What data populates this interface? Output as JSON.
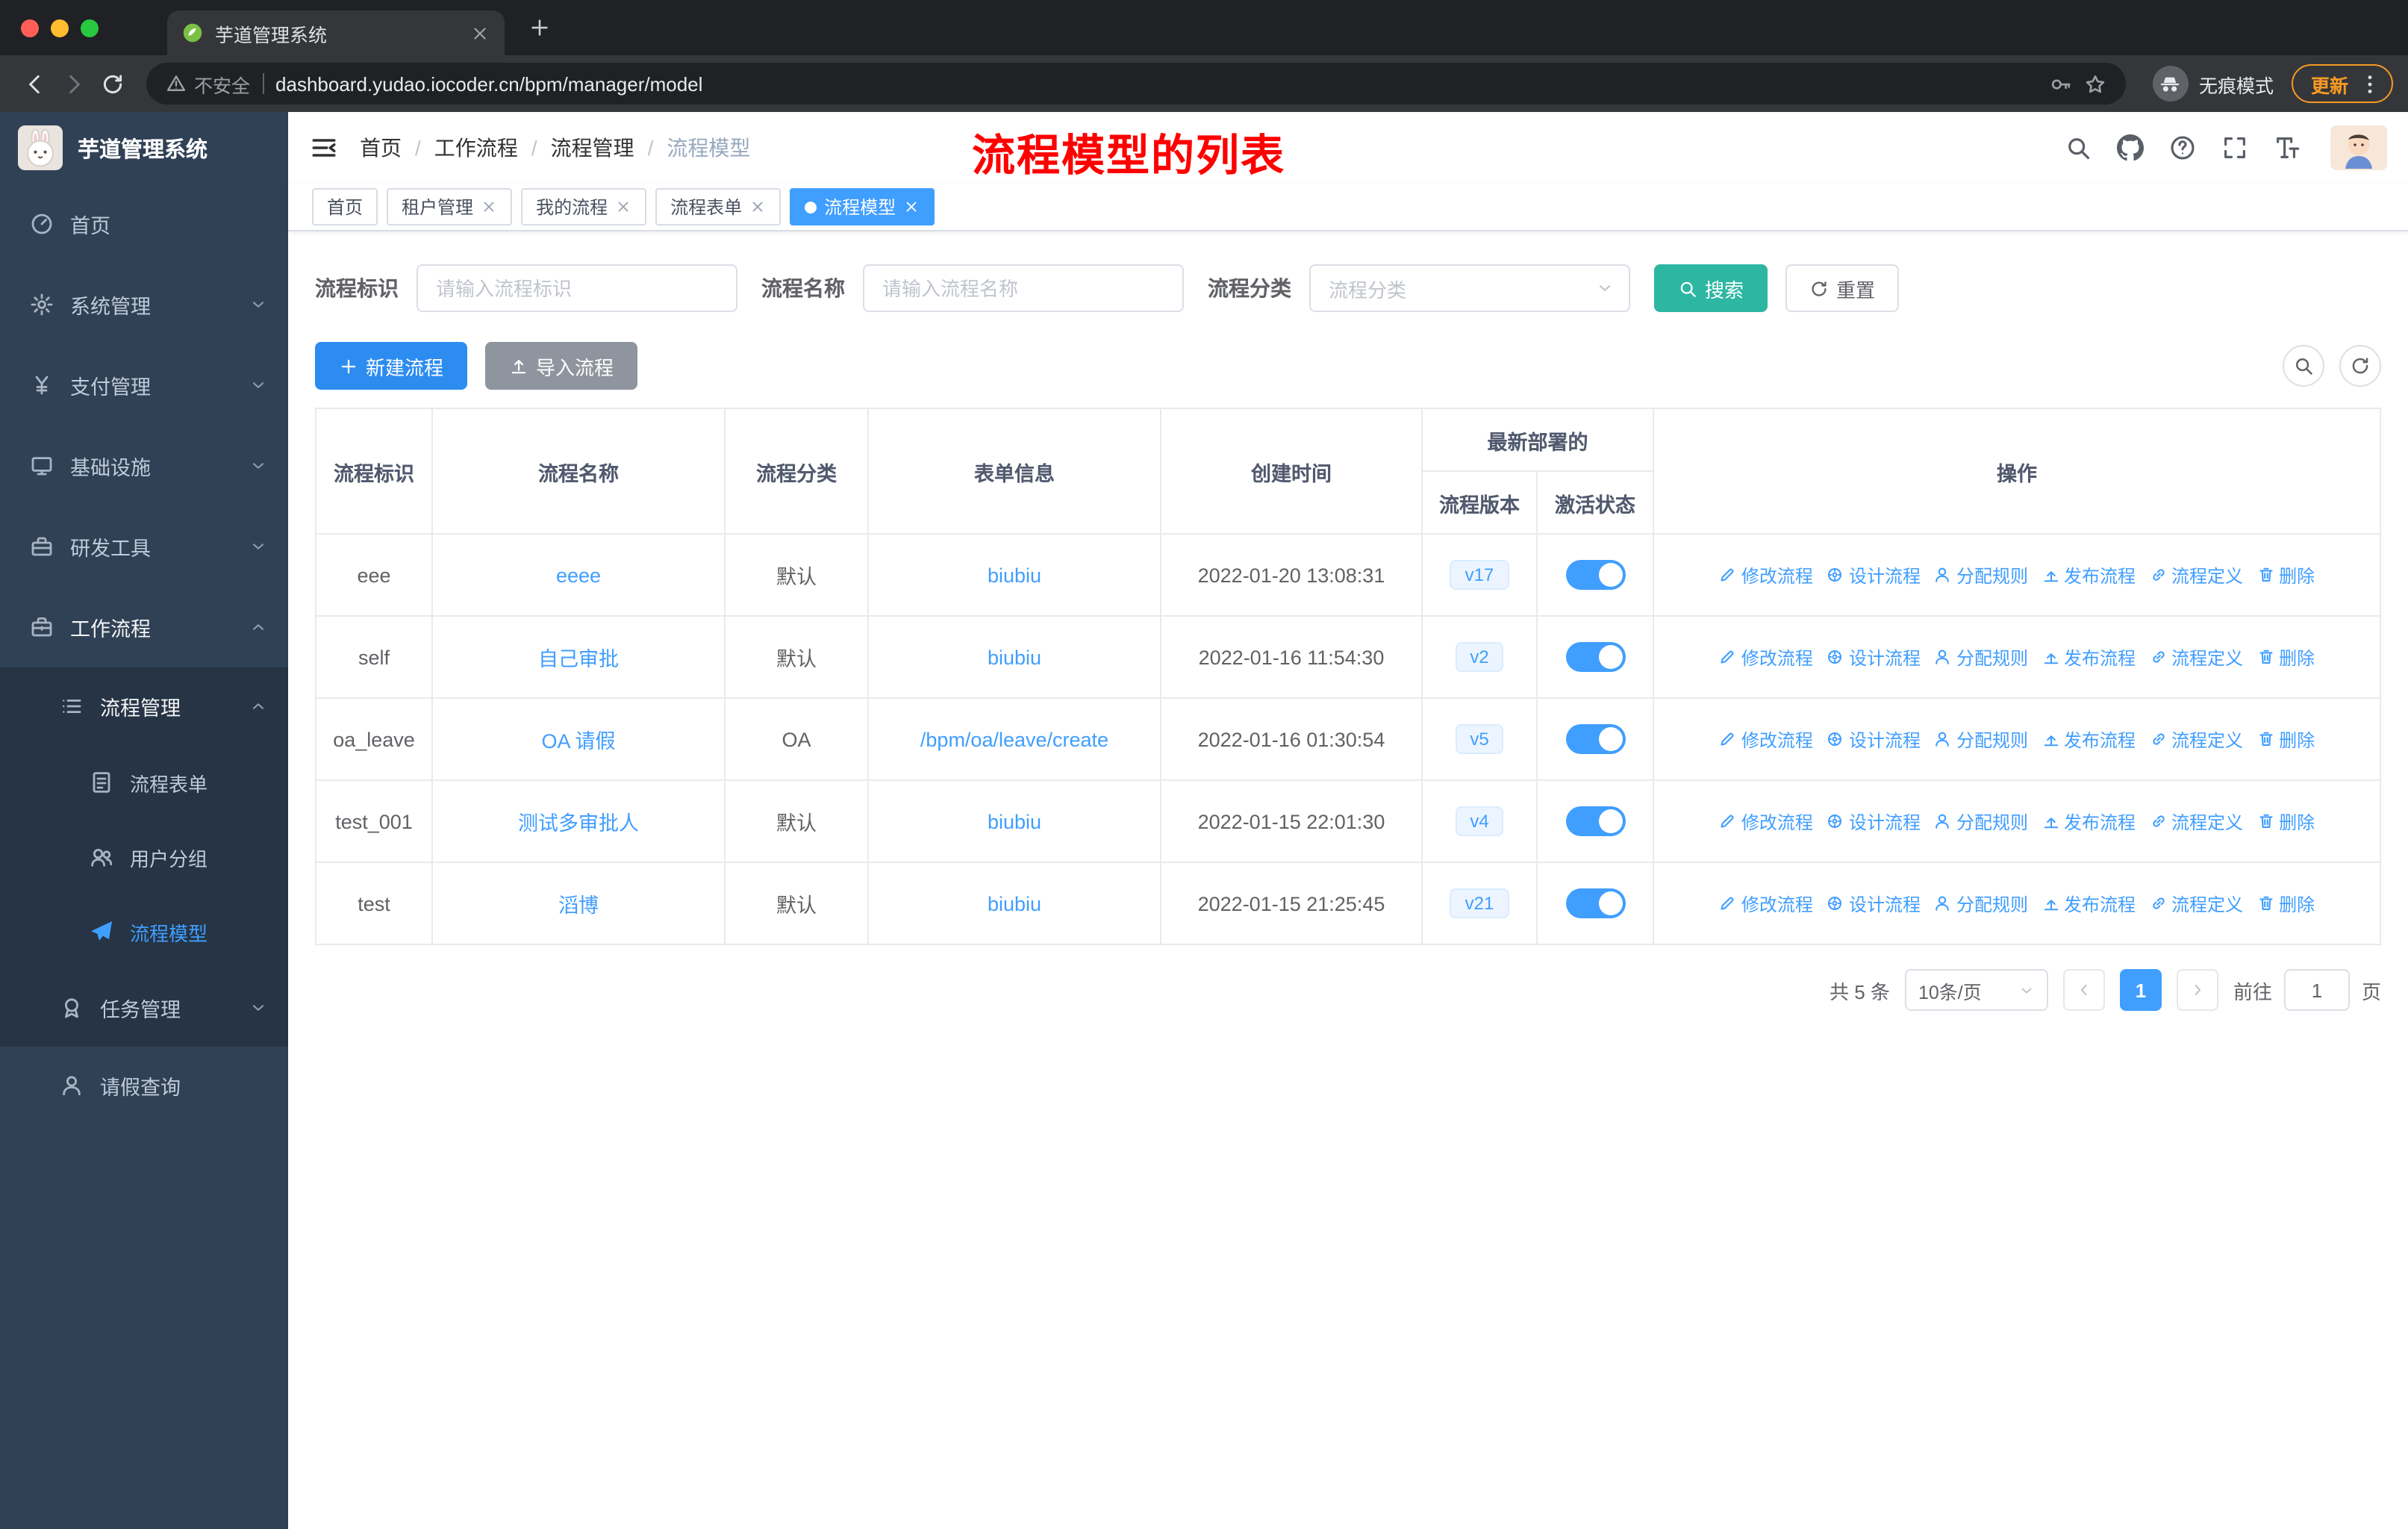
{
  "browser": {
    "tab_title": "芋道管理系统",
    "security_label": "不安全",
    "url": "dashboard.yudao.iocoder.cn/bpm/manager/model",
    "incognito_label": "无痕模式",
    "update_label": "更新"
  },
  "sidebar": {
    "logo_title": "芋道管理系统",
    "items": [
      {
        "id": "home",
        "label": "首页",
        "icon": "dashboard-icon",
        "level": 1
      },
      {
        "id": "system",
        "label": "系统管理",
        "icon": "gear-icon",
        "level": 1,
        "chevron": "down"
      },
      {
        "id": "payment",
        "label": "支付管理",
        "icon": "yen-icon",
        "level": 1,
        "chevron": "down"
      },
      {
        "id": "infrastructure",
        "label": "基础设施",
        "icon": "monitor-icon",
        "level": 1,
        "chevron": "down"
      },
      {
        "id": "dev-tools",
        "label": "研发工具",
        "icon": "tools-icon",
        "level": 1,
        "chevron": "down"
      },
      {
        "id": "workflow",
        "label": "工作流程",
        "icon": "briefcase-icon",
        "level": 1,
        "chevron": "up",
        "open": true
      },
      {
        "id": "process-mgmt",
        "label": "流程管理",
        "icon": "flow-list-icon",
        "level": 2,
        "chevron": "up",
        "dark": true,
        "open": true
      },
      {
        "id": "process-form",
        "label": "流程表单",
        "icon": "document-icon",
        "level": 3,
        "dark": true
      },
      {
        "id": "user-group",
        "label": "用户分组",
        "icon": "user-group-icon",
        "level": 3,
        "dark": true
      },
      {
        "id": "process-model",
        "label": "流程模型",
        "icon": "paper-plane-icon",
        "level": 3,
        "dark": true,
        "active": true
      },
      {
        "id": "task-mgmt",
        "label": "任务管理",
        "icon": "badge-icon",
        "level": 2,
        "chevron": "down",
        "dark": true
      },
      {
        "id": "leave-query",
        "label": "请假查询",
        "icon": "person-icon",
        "level": 2
      }
    ]
  },
  "header": {
    "breadcrumb": [
      "首页",
      "工作流程",
      "流程管理",
      "流程模型"
    ],
    "annotation": "流程模型的列表"
  },
  "tags": [
    {
      "id": "home",
      "label": "首页",
      "closable": false
    },
    {
      "id": "tenant-mgmt",
      "label": "租户管理",
      "closable": true
    },
    {
      "id": "my-process",
      "label": "我的流程",
      "closable": true
    },
    {
      "id": "process-form",
      "label": "流程表单",
      "closable": true
    },
    {
      "id": "process-model",
      "label": "流程模型",
      "closable": true,
      "active": true
    }
  ],
  "filters": {
    "fields": [
      {
        "label": "流程标识",
        "placeholder": "请输入流程标识",
        "type": "input"
      },
      {
        "label": "流程名称",
        "placeholder": "请输入流程名称",
        "type": "input"
      },
      {
        "label": "流程分类",
        "placeholder": "流程分类",
        "type": "select"
      }
    ],
    "search_label": "搜索",
    "reset_label": "重置"
  },
  "toolbar": {
    "create_label": "新建流程",
    "import_label": "导入流程"
  },
  "table": {
    "columns": {
      "key": "流程标识",
      "name": "流程名称",
      "category": "流程分类",
      "form": "表单信息",
      "created": "创建时间",
      "group": "最新部署的",
      "version": "流程版本",
      "status": "激活状态",
      "actions": "操作"
    },
    "rows": [
      {
        "key": "eee",
        "name": "eeee",
        "category": "默认",
        "form": "biubiu",
        "created": "2022-01-20 13:08:31",
        "version": "v17",
        "active": true
      },
      {
        "key": "self",
        "name": "自己审批",
        "category": "默认",
        "form": "biubiu",
        "created": "2022-01-16 11:54:30",
        "version": "v2",
        "active": true
      },
      {
        "key": "oa_leave",
        "name": "OA 请假",
        "category": "OA",
        "form": "/bpm/oa/leave/create",
        "created": "2022-01-16 01:30:54",
        "version": "v5",
        "active": true
      },
      {
        "key": "test_001",
        "name": "测试多审批人",
        "category": "默认",
        "form": "biubiu",
        "created": "2022-01-15 22:01:30",
        "version": "v4",
        "active": true
      },
      {
        "key": "test",
        "name": "滔博",
        "category": "默认",
        "form": "biubiu",
        "created": "2022-01-15 21:25:45",
        "version": "v21",
        "active": true
      }
    ],
    "actions": [
      {
        "id": "modify",
        "label": "修改流程",
        "icon": "edit-icon"
      },
      {
        "id": "design",
        "label": "设计流程",
        "icon": "design-icon"
      },
      {
        "id": "assign-rule",
        "label": "分配规则",
        "icon": "assign-user-icon"
      },
      {
        "id": "deploy",
        "label": "发布流程",
        "icon": "deploy-icon"
      },
      {
        "id": "definition",
        "label": "流程定义",
        "icon": "definition-icon"
      },
      {
        "id": "delete",
        "label": "删除",
        "icon": "delete-icon"
      }
    ]
  },
  "pagination": {
    "total": "共 5 条",
    "page_size": "10条/页",
    "current_page": "1",
    "goto_label": "前往",
    "goto_value": "1",
    "unit_label": "页"
  },
  "colors": {
    "primary": "#409eff",
    "search_button": "#2db7a3",
    "create_button": "#2d8cf0",
    "import_button": "#8f959e",
    "annotation": "#fe0000",
    "update": "#f59a23",
    "toggle_on": "#409eff",
    "sidebar_bg": "#304156",
    "submenu_bg": "#263445"
  }
}
